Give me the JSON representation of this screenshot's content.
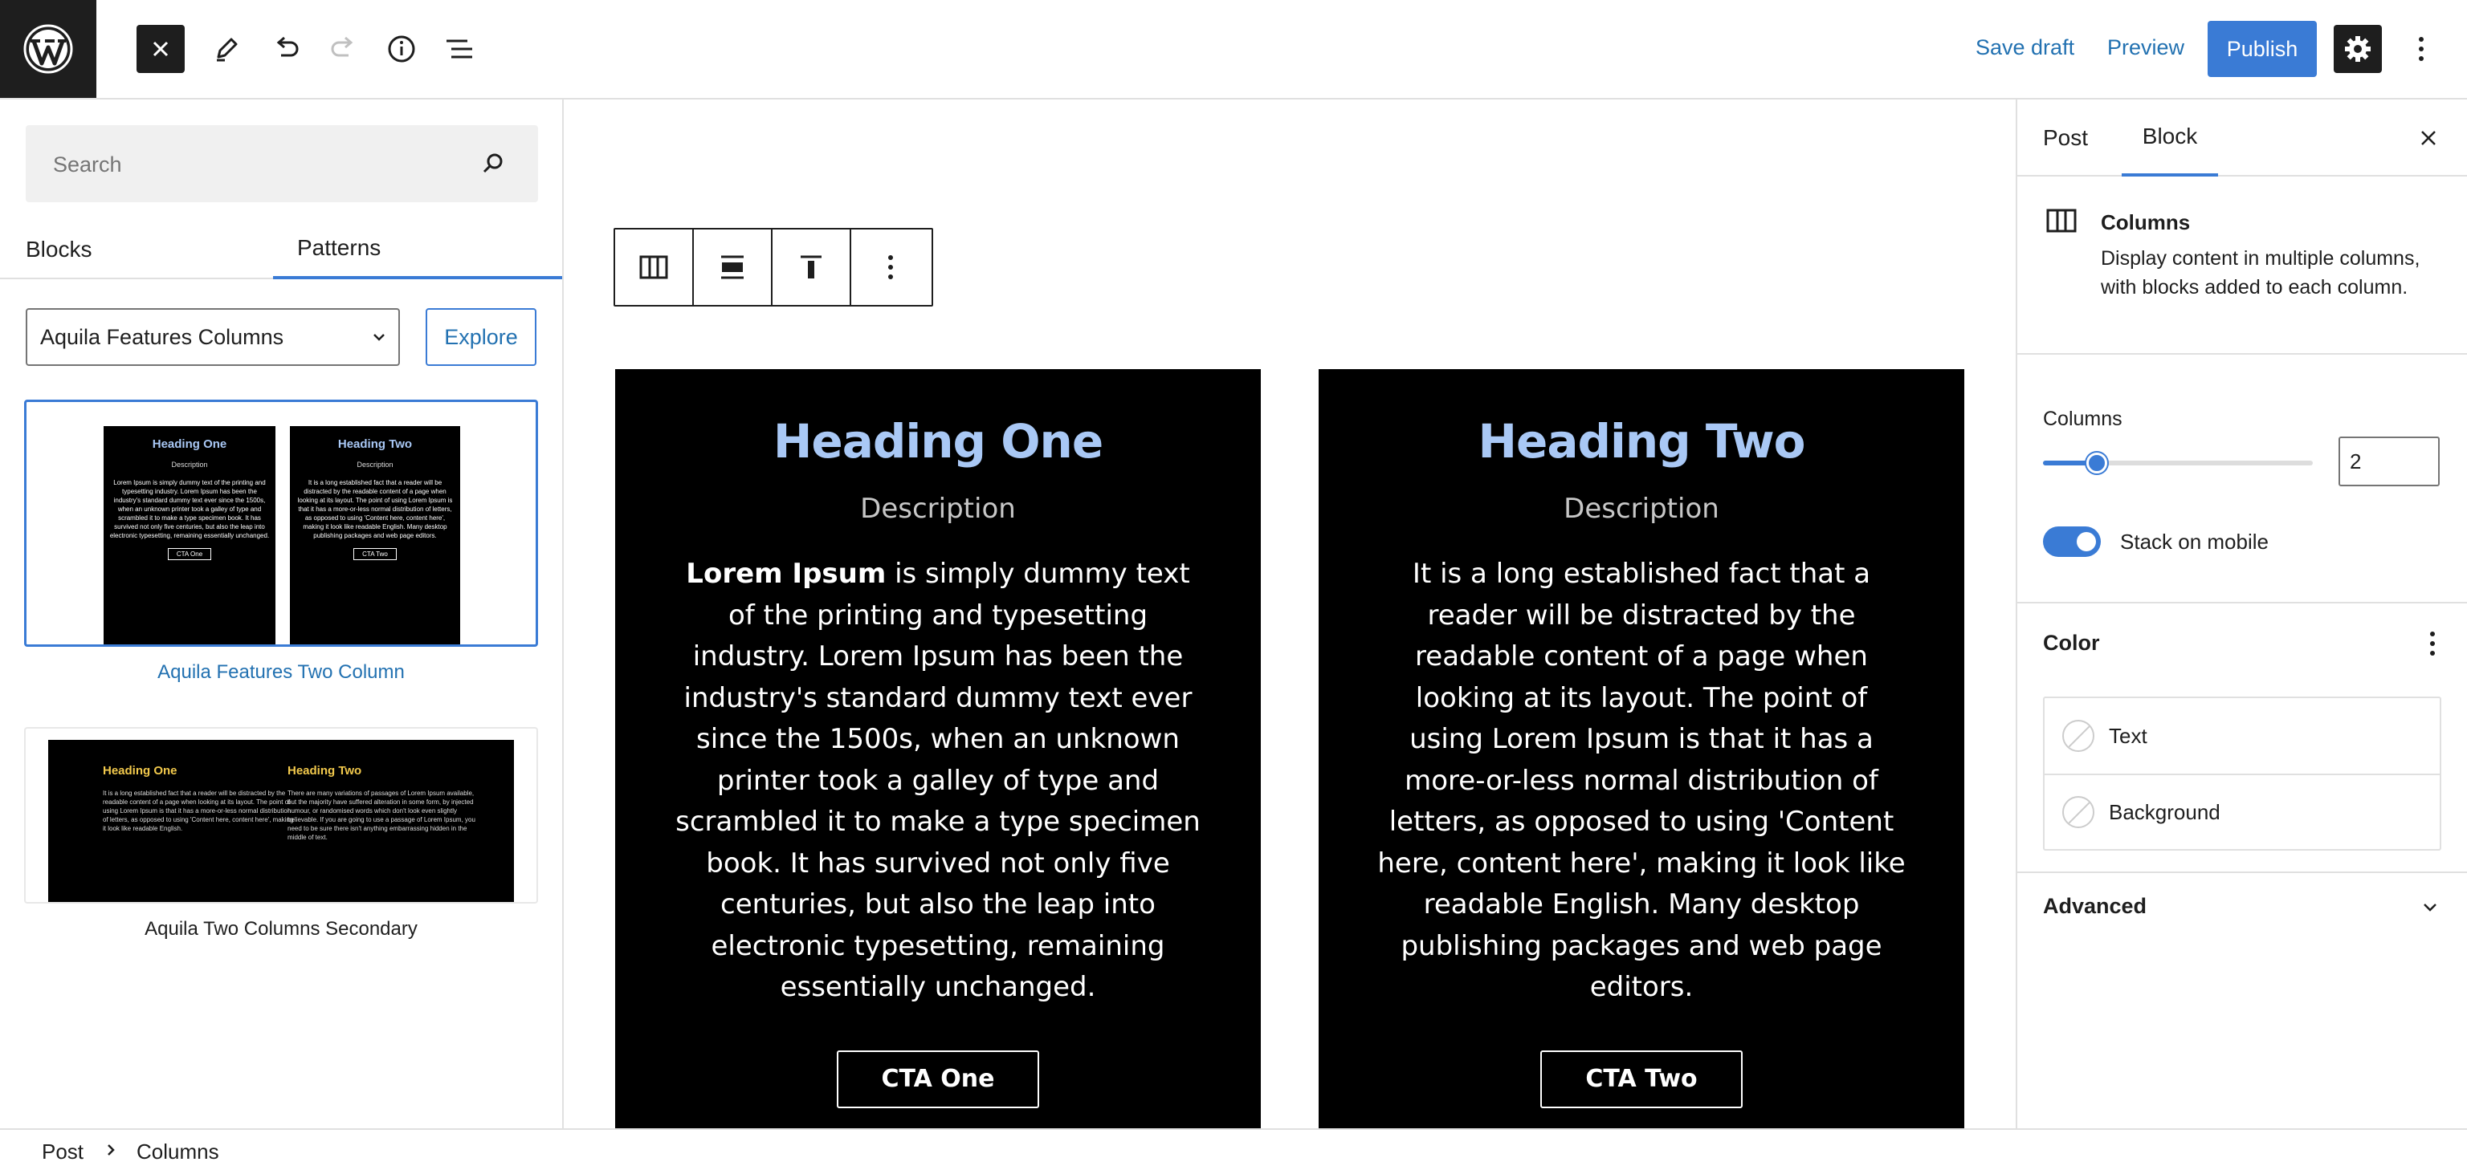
{
  "toolbar": {
    "save_draft": "Save draft",
    "preview": "Preview",
    "publish": "Publish",
    "icons": [
      "wordpress-logo",
      "close-icon",
      "pencil-icon",
      "undo-icon",
      "redo-icon",
      "info-icon",
      "list-view-icon",
      "gear-icon",
      "more-vertical-icon"
    ]
  },
  "inserter": {
    "search_placeholder": "Search",
    "tabs": [
      "Blocks",
      "Patterns"
    ],
    "active_tab": "Patterns",
    "category_selected": "Aquila Features Columns",
    "explore_label": "Explore",
    "patterns": [
      {
        "label": "Aquila Features Two Column",
        "preview": {
          "columns": [
            {
              "heading": "Heading One",
              "description": "Description",
              "text": "Lorem Ipsum is simply dummy text of the printing and typesetting industry. Lorem Ipsum has been the industry's standard dummy text ever since the 1500s, when an unknown printer took a galley of type and scrambled it to make a type specimen book. It has survived not only five centuries, but also the leap into electronic typesetting, remaining essentially unchanged.",
              "cta": "CTA One"
            },
            {
              "heading": "Heading Two",
              "description": "Description",
              "text": "It is a long established fact that a reader will be distracted by the readable content of a page when looking at its layout. The point of using Lorem Ipsum is that it has a more-or-less normal distribution of letters, as opposed to using 'Content here, content here', making it look like readable English. Many desktop publishing packages and web page editors.",
              "cta": "CTA Two"
            }
          ]
        }
      },
      {
        "label": "Aquila Two Columns Secondary",
        "preview": {
          "columns": [
            {
              "heading": "Heading One",
              "text": "It is a long established fact that a reader will be distracted by the readable content of a page when looking at its layout. The point of using Lorem Ipsum is that it has a more-or-less normal distribution of letters, as opposed to using 'Content here, content here', making it look like readable English."
            },
            {
              "heading": "Heading Two",
              "text": "There are many variations of passages of Lorem Ipsum available, but the majority have suffered alteration in some form, by injected humour, or randomised words which don't look even slightly believable. If you are going to use a passage of Lorem Ipsum, you need to be sure there isn't anything embarrassing hidden in the middle of text."
            }
          ]
        }
      }
    ]
  },
  "canvas": {
    "block_toolbar_icons": [
      "columns-icon",
      "align-wide-icon",
      "vertical-align-top-icon",
      "more-vertical-icon"
    ],
    "columns": [
      {
        "heading": "Heading One",
        "description": "Description",
        "text_bold": "Lorem Ipsum",
        "text": " is simply dummy text of the printing and typesetting industry. Lorem Ipsum has been the industry's standard dummy text ever since the 1500s, when an unknown printer took a galley of type and scrambled it to make a type specimen book. It has survived not only five centuries, but also the leap into electronic typesetting, remaining essentially unchanged.",
        "cta": "CTA One"
      },
      {
        "heading": "Heading Two",
        "description": "Description",
        "text": "It is a long established fact that a reader will be distracted by the readable content of a page when looking at its layout. The point of using Lorem Ipsum is that it has a more-or-less normal distribution of letters, as opposed to using 'Content here, content here', making it look like readable English. Many desktop publishing packages and web page editors.",
        "cta": "CTA Two"
      }
    ]
  },
  "sidebar": {
    "tabs": [
      "Post",
      "Block"
    ],
    "active_tab": "Block",
    "block_card": {
      "title": "Columns",
      "description": "Display content in multiple columns, with blocks added to each column."
    },
    "columns_setting": {
      "label": "Columns",
      "value": "2",
      "slider_min": 1,
      "slider_max": 6,
      "slider_value": 2
    },
    "stack_on_mobile": {
      "label": "Stack on mobile",
      "enabled": true
    },
    "color": {
      "title": "Color",
      "items": [
        "Text",
        "Background"
      ]
    },
    "advanced": {
      "title": "Advanced"
    }
  },
  "breadcrumb": [
    "Post",
    "Columns"
  ],
  "colors": {
    "accent": "#3a7bd5",
    "link": "#2271b1",
    "heading_blue": "#a9c8f5",
    "heading_yellow": "#f2c94c",
    "dark": "#1e1e1e"
  }
}
